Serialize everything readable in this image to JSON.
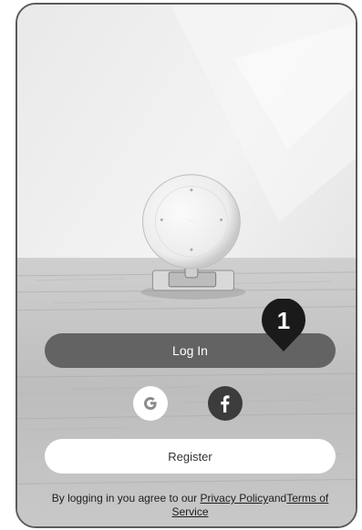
{
  "login": {
    "label": "Log In"
  },
  "social": {
    "google_icon": "google-g-icon",
    "google_letter": "G",
    "facebook_icon": "facebook-f-icon",
    "facebook_letter": "f"
  },
  "register": {
    "label": "Register"
  },
  "terms": {
    "prefix": "By logging in you agree to our ",
    "privacy_label": "Privacy Policy",
    "and": "and",
    "tos_label": "Terms of Service"
  },
  "annotation": {
    "number": "1"
  },
  "colors": {
    "login_bg": "#636363",
    "button_bg": "#ffffff",
    "facebook_bg": "#3c3c3c",
    "frame": "#5a5a5a"
  }
}
